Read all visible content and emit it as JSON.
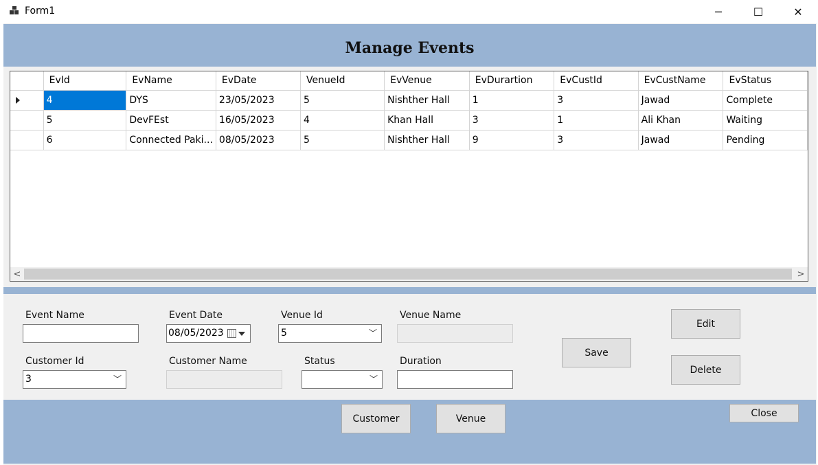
{
  "window": {
    "title": "Form1",
    "minimize_glyph": "─",
    "maximize_glyph": "☐",
    "close_glyph": "✕"
  },
  "header": {
    "title": "Manage Events"
  },
  "grid": {
    "columns": [
      "EvId",
      "EvName",
      "EvDate",
      "VenueId",
      "EvVenue",
      "EvDurartion",
      "EvCustId",
      "EvCustName",
      "EvStatus"
    ],
    "rows": [
      [
        "4",
        "DYS",
        "23/05/2023",
        "5",
        "Nishther Hall",
        "1",
        "3",
        "Jawad",
        "Complete"
      ],
      [
        "5",
        "DevFEst",
        "16/05/2023",
        "4",
        "Khan Hall",
        "3",
        "1",
        "Ali Khan",
        "Waiting"
      ],
      [
        "6",
        "Connected Paki...",
        "08/05/2023",
        "5",
        "Nishther Hall",
        "9",
        "3",
        "Jawad",
        "Pending"
      ]
    ],
    "selected_row": 0,
    "scroll_left": "<",
    "scroll_right": ">"
  },
  "fields": {
    "event_name": {
      "label": "Event Name",
      "value": ""
    },
    "event_date": {
      "label": "Event Date",
      "value": "08/05/2023"
    },
    "venue_id": {
      "label": "Venue Id",
      "value": "5"
    },
    "venue_name": {
      "label": "Venue Name",
      "value": ""
    },
    "customer_id": {
      "label": "Customer Id",
      "value": "3"
    },
    "customer_name": {
      "label": "Customer Name",
      "value": ""
    },
    "status": {
      "label": "Status",
      "value": ""
    },
    "duration": {
      "label": "Duration",
      "value": ""
    }
  },
  "buttons": {
    "save": "Save",
    "edit": "Edit",
    "delete": "Delete",
    "customer": "Customer",
    "venue": "Venue",
    "close": "Close"
  },
  "colors": {
    "band": "#98b3d3",
    "selection": "#0078d7",
    "form_bg": "#f0f0f0"
  }
}
